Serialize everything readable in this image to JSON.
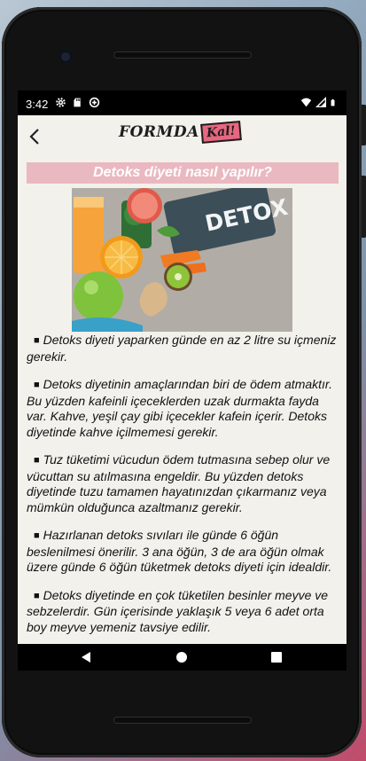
{
  "status": {
    "time": "3:42",
    "left_icons": [
      "gear-icon",
      "sd-card-icon",
      "data-saver-icon"
    ],
    "right_icons": [
      "wifi-icon",
      "signal-icon",
      "battery-icon"
    ]
  },
  "toolbar": {
    "back_icon": "chevron-left-icon",
    "logo_text": "FORMDA",
    "logo_box_text": "Kal!"
  },
  "article": {
    "title": "Detoks diyeti nasıl yapılır?",
    "image_text": "DETOX",
    "bullet": "■",
    "paragraphs": [
      "Detoks diyeti yaparken günde en az 2 litre su içmeniz gerekir.",
      "Detoks diyetinin amaçlarından biri de ödem atmaktır. Bu yüzden kafeinli içeceklerden uzak durmakta fayda var. Kahve, yeşil çay gibi içecekler kafein içerir. Detoks diyetinde kahve içilmemesi gerekir.",
      "Tuz tüketimi vücudun ödem tutmasına sebep olur ve vücuttan su atılmasına engeldir. Bu yüzden detoks diyetinde tuzu tamamen hayatınızdan çıkarmanız veya mümkün olduğunca azaltmanız gerekir.",
      "Hazırlanan detoks sıvıları ile günde 6 öğün beslenilmesi önerilir. 3 ana öğün, 3 de ara öğün olmak üzere günde 6 öğün tüketmek detoks diyeti için idealdir.",
      "Detoks diyetinde en çok tüketilen besinler meyve ve sebzelerdir. Gün içerisinde yaklaşık 5 veya 6 adet orta boy meyve yemeniz tavsiye edilir."
    ]
  },
  "navbar": {
    "icons": [
      "back-triangle-icon",
      "home-circle-icon",
      "recents-square-icon"
    ]
  },
  "colors": {
    "app_background": "#f3f1ec",
    "title_bar": "#eab8c0",
    "logo_box": "#e8667f"
  }
}
